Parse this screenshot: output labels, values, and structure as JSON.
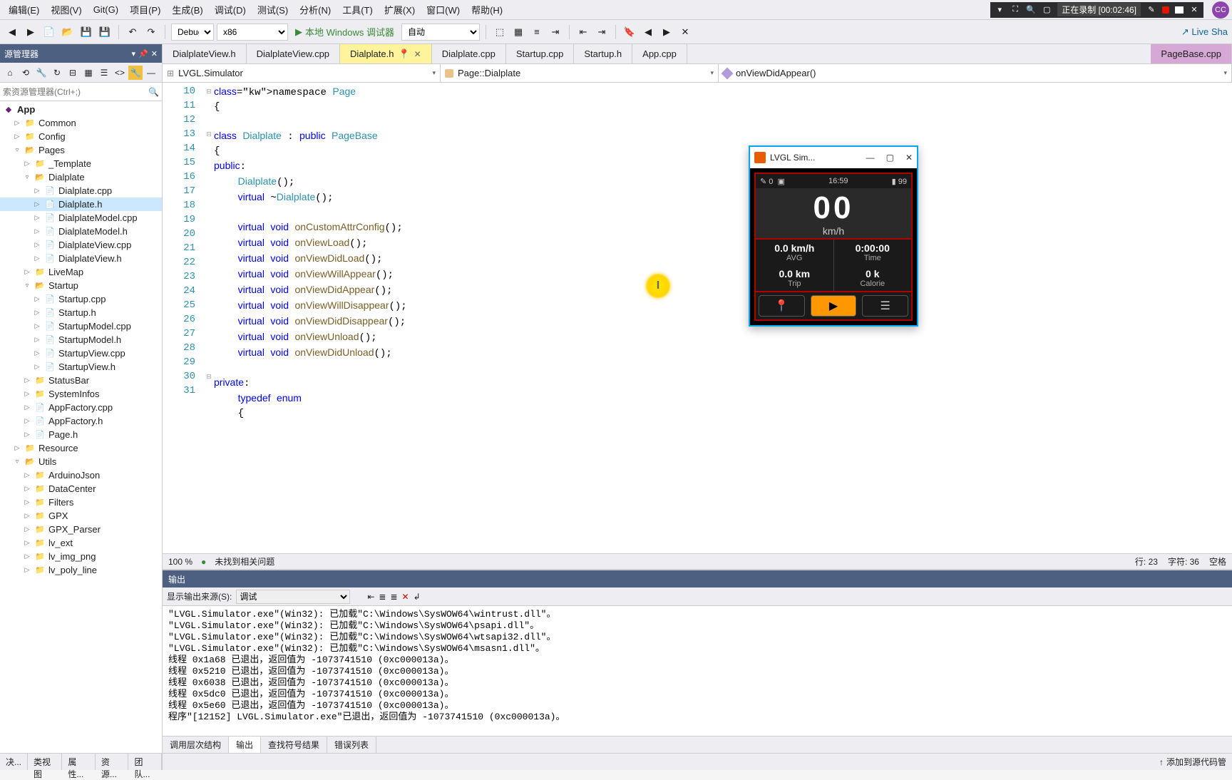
{
  "menu": {
    "items": [
      "编辑(E)",
      "视图(V)",
      "Git(G)",
      "项目(P)",
      "生成(B)",
      "调试(D)",
      "测试(S)",
      "分析(N)",
      "工具(T)",
      "扩展(X)",
      "窗口(W)",
      "帮助(H)"
    ]
  },
  "recording": {
    "label": "正在录制 [00:02:46]"
  },
  "user_initials": "CC",
  "toolbar": {
    "config": "Debug",
    "platform": "x86",
    "debug_target": "本地 Windows 调试器",
    "auto": "自动",
    "live_share": "Live Sha"
  },
  "explorer": {
    "title": "源管理器",
    "search_placeholder": "索资源管理器(Ctrl+;)",
    "root": "App",
    "folders_top": [
      "Common",
      "Config"
    ],
    "pages": "Pages",
    "template": "_Template",
    "dialplate": {
      "name": "Dialplate",
      "files": [
        "Dialplate.cpp",
        "Dialplate.h",
        "DialplateModel.cpp",
        "DialplateModel.h",
        "DialplateView.cpp",
        "DialplateView.h"
      ]
    },
    "live_map": "LiveMap",
    "startup": {
      "name": "Startup",
      "files": [
        "Startup.cpp",
        "Startup.h",
        "StartupModel.cpp",
        "StartupModel.h",
        "StartupView.cpp",
        "StartupView.h"
      ]
    },
    "mid_folders": [
      "StatusBar",
      "SystemInfos"
    ],
    "mid_files": [
      "AppFactory.cpp",
      "AppFactory.h",
      "Page.h"
    ],
    "resource": "Resource",
    "utils": {
      "name": "Utils",
      "items": [
        "ArduinoJson",
        "DataCenter",
        "Filters",
        "GPX",
        "GPX_Parser",
        "lv_ext",
        "lv_img_png",
        "lv_poly_line"
      ]
    },
    "bottom_tabs": [
      "决...",
      "类视图",
      "属性...",
      "资源...",
      "团队..."
    ]
  },
  "editor": {
    "tabs": [
      "DialplateView.h",
      "DialplateView.cpp",
      "Dialplate.h",
      "Dialplate.cpp",
      "Startup.cpp",
      "Startup.h",
      "App.cpp"
    ],
    "active_tab": "Dialplate.h",
    "right_tab": "PageBase.cpp",
    "nav_project": "LVGL.Simulator",
    "nav_class": "Page::Dialplate",
    "nav_function": "onViewDidAppear()",
    "zoom": "100 %",
    "issue_status": "未找到相关问题",
    "line_info": "行: 23",
    "char_info": "字符: 36",
    "space_label": "空格"
  },
  "code": {
    "lines": [
      {
        "n": 10,
        "t": "namespace Page"
      },
      {
        "n": 11,
        "t": "{"
      },
      {
        "n": 12,
        "t": ""
      },
      {
        "n": 13,
        "t": "class Dialplate : public PageBase"
      },
      {
        "n": 14,
        "t": "{"
      },
      {
        "n": 15,
        "t": "public:"
      },
      {
        "n": 16,
        "t": "    Dialplate();"
      },
      {
        "n": 17,
        "t": "    virtual ~Dialplate();"
      },
      {
        "n": 18,
        "t": ""
      },
      {
        "n": 19,
        "t": "    virtual void onCustomAttrConfig();"
      },
      {
        "n": 20,
        "t": "    virtual void onViewLoad();"
      },
      {
        "n": 21,
        "t": "    virtual void onViewDidLoad();"
      },
      {
        "n": 22,
        "t": "    virtual void onViewWillAppear();"
      },
      {
        "n": 23,
        "t": "    virtual void onViewDidAppear();"
      },
      {
        "n": 24,
        "t": "    virtual void onViewWillDisappear();"
      },
      {
        "n": 25,
        "t": "    virtual void onViewDidDisappear();"
      },
      {
        "n": 26,
        "t": "    virtual void onViewUnload();"
      },
      {
        "n": 27,
        "t": "    virtual void onViewDidUnload();"
      },
      {
        "n": 28,
        "t": ""
      },
      {
        "n": 29,
        "t": "private:"
      },
      {
        "n": 30,
        "t": "    typedef enum"
      },
      {
        "n": 31,
        "t": "    {"
      }
    ]
  },
  "output": {
    "title": "输出",
    "source_label": "显示输出来源(S):",
    "source_value": "调试",
    "lines": [
      "\"LVGL.Simulator.exe\"(Win32): 已加载\"C:\\Windows\\SysWOW64\\wintrust.dll\"。",
      "\"LVGL.Simulator.exe\"(Win32): 已加载\"C:\\Windows\\SysWOW64\\psapi.dll\"。",
      "\"LVGL.Simulator.exe\"(Win32): 已加载\"C:\\Windows\\SysWOW64\\wtsapi32.dll\"。",
      "\"LVGL.Simulator.exe\"(Win32): 已加载\"C:\\Windows\\SysWOW64\\msasn1.dll\"。",
      "线程 0x1a68 已退出，返回值为 -1073741510 (0xc000013a)。",
      "线程 0x5210 已退出，返回值为 -1073741510 (0xc000013a)。",
      "线程 0x6038 已退出，返回值为 -1073741510 (0xc000013a)。",
      "线程 0x5dc0 已退出，返回值为 -1073741510 (0xc000013a)。",
      "线程 0x5e60 已退出，返回值为 -1073741510 (0xc000013a)。",
      "程序\"[12152] LVGL.Simulator.exe\"已退出，返回值为 -1073741510 (0xc000013a)。"
    ],
    "tabs": [
      "调用层次结构",
      "输出",
      "查找符号结果",
      "错误列表"
    ]
  },
  "bottom": {
    "source_control": "添加到源代码管"
  },
  "sim": {
    "title": "LVGL Sim...",
    "time": "16:59",
    "battery": "99",
    "speed": "00",
    "unit": "km/h",
    "avg_val": "0.0 km/h",
    "avg_lbl": "AVG",
    "time_val": "0:00:00",
    "time_lbl": "Time",
    "trip_val": "0.0 km",
    "trip_lbl": "Trip",
    "cal_val": "0 k",
    "cal_lbl": "Calorie"
  }
}
